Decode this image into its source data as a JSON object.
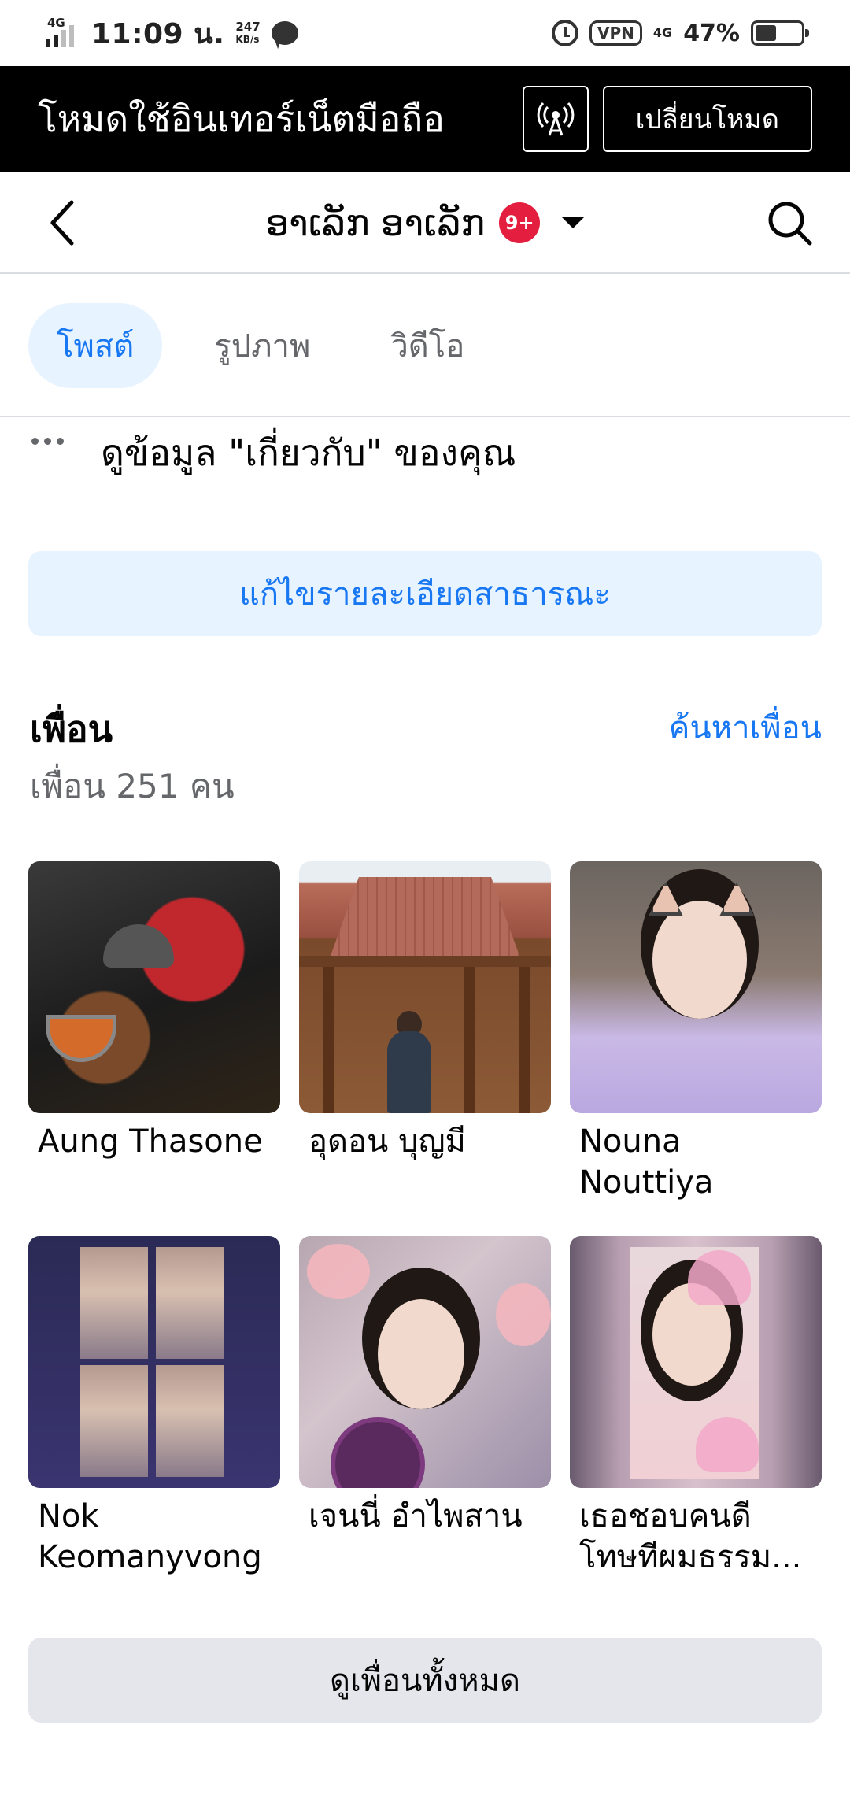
{
  "status_bar": {
    "network": "4G",
    "time": "11:09 น.",
    "speed_value": "247",
    "speed_unit": "KB/s",
    "vpn": "VPN",
    "data_type": "4G",
    "battery": "47%",
    "battery_level": 0.47
  },
  "data_banner": {
    "text": "โหมดใช้อินเทอร์เน็ตมือถือ",
    "icon": "signal-tower-icon",
    "switch_label": "เปลี่ยนโหมด"
  },
  "header": {
    "profile_name": "ອາເລັກ ອາເລັກ",
    "badge": "9+"
  },
  "tabs": [
    {
      "label": "โพสต์",
      "active": true
    },
    {
      "label": "รูปภาพ",
      "active": false
    },
    {
      "label": "วิดีโอ",
      "active": false
    }
  ],
  "about": {
    "text": "ดูข้อมูล \"เกี่ยวกับ\" ของคุณ"
  },
  "edit_button": "แก้ไขรายละเอียดสาธารณะ",
  "friends": {
    "title": "เพื่อน",
    "find_link": "ค้นหาเพื่อน",
    "count": "เพื่อน 251 คน",
    "items": [
      {
        "name": "Aung Thasone"
      },
      {
        "name": "อุดอน บุญมี"
      },
      {
        "name": "Nouna Nouttiya"
      },
      {
        "name": "Nok Keomanyvong"
      },
      {
        "name": "เจนนี่ อำไพสาน"
      },
      {
        "name": "เธอชอบคนดี โทษทีผมธรรม..."
      }
    ],
    "see_all": "ดูเพื่อนทั้งหมด"
  },
  "colors": {
    "accent": "#1877f2",
    "accent_bg": "#e7f3ff",
    "badge": "#e41e3f",
    "banner_bg": "#000000",
    "secondary_text": "#65676b"
  }
}
